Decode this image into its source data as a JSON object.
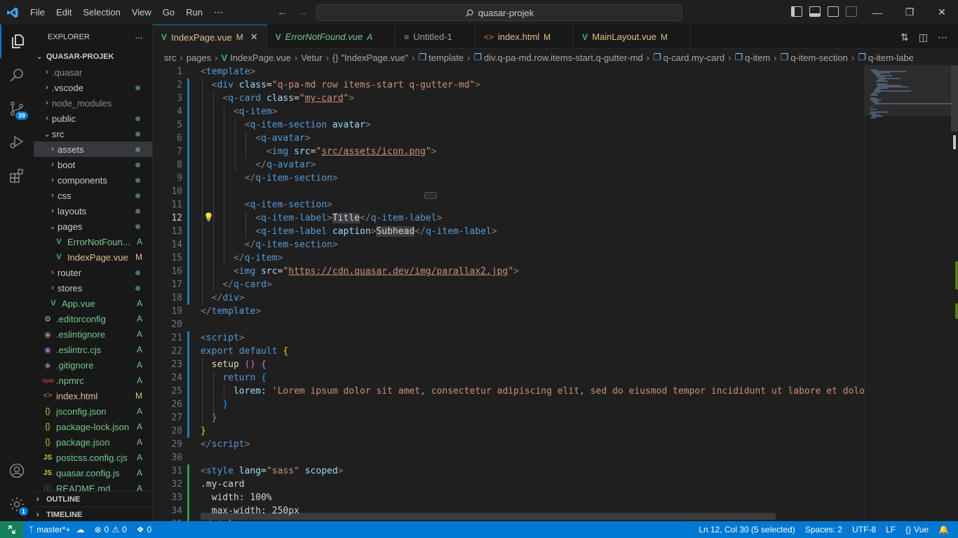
{
  "titlebar": {
    "menu": [
      "File",
      "Edit",
      "Selection",
      "View",
      "Go",
      "Run",
      "⋯"
    ],
    "command_center": "quasar-projek"
  },
  "activity": {
    "source_control_badge": "39",
    "settings_badge": "1"
  },
  "sidebar": {
    "title": "EXPLORER",
    "more": "···",
    "folder": "QUASAR-PROJEK",
    "items": [
      {
        "label": ".quasar",
        "kind": "folder",
        "depth": 1,
        "status": ""
      },
      {
        "label": ".vscode",
        "kind": "folder",
        "depth": 1,
        "status": "dot"
      },
      {
        "label": "node_modules",
        "kind": "folder",
        "depth": 1,
        "status": ""
      },
      {
        "label": "public",
        "kind": "folder",
        "depth": 1,
        "status": "dot"
      },
      {
        "label": "src",
        "kind": "folder-open",
        "depth": 1,
        "status": "dot"
      },
      {
        "label": "assets",
        "kind": "folder",
        "depth": 2,
        "status": "dot",
        "selected": true
      },
      {
        "label": "boot",
        "kind": "folder",
        "depth": 2,
        "status": "dot"
      },
      {
        "label": "components",
        "kind": "folder",
        "depth": 2,
        "status": "dot"
      },
      {
        "label": "css",
        "kind": "folder",
        "depth": 2,
        "status": "dot"
      },
      {
        "label": "layouts",
        "kind": "folder",
        "depth": 2,
        "status": "dotmod"
      },
      {
        "label": "pages",
        "kind": "folder-open",
        "depth": 2,
        "status": "dot"
      },
      {
        "label": "ErrorNotFoun...",
        "kind": "vue",
        "depth": 3,
        "status": "A"
      },
      {
        "label": "IndexPage.vue",
        "kind": "vue",
        "depth": 3,
        "status": "M"
      },
      {
        "label": "router",
        "kind": "folder",
        "depth": 2,
        "status": "dot"
      },
      {
        "label": "stores",
        "kind": "folder",
        "depth": 2,
        "status": "dot"
      },
      {
        "label": "App.vue",
        "kind": "vue",
        "depth": 2,
        "status": "A"
      },
      {
        "label": ".editorconfig",
        "kind": "cfg",
        "depth": 1,
        "status": "A"
      },
      {
        "label": ".eslintignore",
        "kind": "eslint",
        "depth": 1,
        "status": "A"
      },
      {
        "label": ".eslintrc.cjs",
        "kind": "eslintrc",
        "depth": 1,
        "status": "A"
      },
      {
        "label": ".gitignore",
        "kind": "git",
        "depth": 1,
        "status": "A"
      },
      {
        "label": ".npmrc",
        "kind": "npm",
        "depth": 1,
        "status": "A"
      },
      {
        "label": "index.html",
        "kind": "html",
        "depth": 1,
        "status": "M"
      },
      {
        "label": "jsconfig.json",
        "kind": "json",
        "depth": 1,
        "status": "A"
      },
      {
        "label": "package-lock.json",
        "kind": "json",
        "depth": 1,
        "status": "A"
      },
      {
        "label": "package.json",
        "kind": "json",
        "depth": 1,
        "status": "A"
      },
      {
        "label": "postcss.config.cjs",
        "kind": "js",
        "depth": 1,
        "status": "A"
      },
      {
        "label": "quasar.config.js",
        "kind": "js",
        "depth": 1,
        "status": "A"
      },
      {
        "label": "README.md",
        "kind": "info",
        "depth": 1,
        "status": "A"
      }
    ],
    "outline": "OUTLINE",
    "timeline": "TIMELINE"
  },
  "tabs": [
    {
      "label": "IndexPage.vue",
      "status": "M",
      "kind": "vue",
      "active": true,
      "close": "✕"
    },
    {
      "label": "ErrorNotFound.vue",
      "status": "A",
      "kind": "vue",
      "italic": true
    },
    {
      "label": "Untitled-1",
      "status": "",
      "kind": "text"
    },
    {
      "label": "index.html",
      "status": "M",
      "kind": "html"
    },
    {
      "label": "MainLayout.vue",
      "status": "M",
      "kind": "vue"
    }
  ],
  "breadcrumb": [
    "src",
    "pages",
    "IndexPage.vue",
    "Vetur",
    "{} \"IndexPage.vue\"",
    "template",
    "div.q-pa-md.row.items-start.q-gutter-md",
    "q-card.my-card",
    "q-item",
    "q-item-section",
    "q-item-labe"
  ],
  "editor": {
    "current_line": 12,
    "lines": [
      {
        "n": "1",
        "h": "<span class='t-br'>&lt;</span><span class='t-tag'>template</span><span class='t-br'>&gt;</span>"
      },
      {
        "n": "2",
        "h": "  <span class='t-br'>&lt;</span><span class='t-tag'>div</span> <span class='t-attr'>class</span>=<span class='t-str'>\"q-pa-md row items-start q-gutter-md\"</span><span class='t-br'>&gt;</span>"
      },
      {
        "n": "3",
        "h": "    <span class='t-br'>&lt;</span><span class='t-tag'>q-card</span> <span class='t-attr'>class</span>=<span class='t-str'>\"<span class='u'>my-card</span>\"</span><span class='t-br'>&gt;</span>"
      },
      {
        "n": "4",
        "h": "      <span class='t-br'>&lt;</span><span class='t-tag'>q-item</span><span class='t-br'>&gt;</span>"
      },
      {
        "n": "5",
        "h": "        <span class='t-br'>&lt;</span><span class='t-tag'>q-item-section</span> <span class='t-attr'>avatar</span><span class='t-br'>&gt;</span>"
      },
      {
        "n": "6",
        "h": "          <span class='t-br'>&lt;</span><span class='t-tag'>q-avatar</span><span class='t-br'>&gt;</span>"
      },
      {
        "n": "7",
        "h": "            <span class='t-br'>&lt;</span><span class='t-tag'>img</span> <span class='t-attr'>src</span>=<span class='t-str'>\"<span class='u'>src/assets/icon.png</span>\"</span><span class='t-br'>&gt;</span>"
      },
      {
        "n": "8",
        "h": "          <span class='t-br'>&lt;/</span><span class='t-tag'>q-avatar</span><span class='t-br'>&gt;</span>"
      },
      {
        "n": "9",
        "h": "        <span class='t-br'>&lt;/</span><span class='t-tag'>q-item-section</span><span class='t-br'>&gt;</span>"
      },
      {
        "n": "10",
        "h": ""
      },
      {
        "n": "11",
        "h": "        <span class='t-br'>&lt;</span><span class='t-tag'>q-item-section</span><span class='t-br'>&gt;</span>"
      },
      {
        "n": "12",
        "h": "          <span class='t-br'>&lt;</span><span class='t-tag'>q-item-label</span><span class='t-br'>&gt;</span><span class='t-sel'>Title</span><span class='t-br'>&lt;/</span><span class='t-tag'>q-item-label</span><span class='t-br'>&gt;</span>"
      },
      {
        "n": "13",
        "h": "          <span class='t-br'>&lt;</span><span class='t-tag'>q-item-label</span> <span class='t-attr'>caption</span><span class='t-br'>&gt;</span><span class='t-sel'>Subhead</span><span class='t-br'>&lt;/</span><span class='t-tag'>q-item-label</span><span class='t-br'>&gt;</span>"
      },
      {
        "n": "14",
        "h": "        <span class='t-br'>&lt;/</span><span class='t-tag'>q-item-section</span><span class='t-br'>&gt;</span>"
      },
      {
        "n": "15",
        "h": "      <span class='t-br'>&lt;/</span><span class='t-tag'>q-item</span><span class='t-br'>&gt;</span>"
      },
      {
        "n": "16",
        "h": "      <span class='t-br'>&lt;</span><span class='t-tag'>img</span> <span class='t-attr'>src</span>=<span class='t-str'>\"<span class='u'>https://cdn.quasar.dev/img/parallax2.jpg</span>\"</span><span class='t-br'>&gt;</span>"
      },
      {
        "n": "17",
        "h": "    <span class='t-br'>&lt;/</span><span class='t-tag'>q-card</span><span class='t-br'>&gt;</span>"
      },
      {
        "n": "18",
        "h": "  <span class='t-br'>&lt;/</span><span class='t-tag'>div</span><span class='t-br'>&gt;</span>"
      },
      {
        "n": "19",
        "h": "<span class='t-br'>&lt;/</span><span class='t-tag'>template</span><span class='t-br'>&gt;</span>"
      },
      {
        "n": "20",
        "h": ""
      },
      {
        "n": "21",
        "h": "<span class='t-br'>&lt;</span><span class='t-tag'>script</span><span class='t-br'>&gt;</span>"
      },
      {
        "n": "22",
        "h": "<span class='t-kw'>export</span> <span class='t-kw'>default</span> <span class='t-p1'>{</span>"
      },
      {
        "n": "23",
        "h": "  <span class='t-fn'>setup</span> <span class='t-p2'>()</span> <span class='t-p2'>{</span>"
      },
      {
        "n": "24",
        "h": "    <span class='t-kw'>return</span> <span class='t-p3'>{</span>"
      },
      {
        "n": "25",
        "h": "      <span class='t-attr'>lorem</span>: <span class='t-str'>'Lorem ipsum dolor sit amet, consectetur adipiscing elit, sed do eiusmod tempor incididunt ut labore et dolore</span>"
      },
      {
        "n": "26",
        "h": "    <span class='t-p3'>}</span>"
      },
      {
        "n": "27",
        "h": "  <span class='t-p2'>}</span>"
      },
      {
        "n": "28",
        "h": "<span class='t-p1'>}</span>"
      },
      {
        "n": "29",
        "h": "<span class='t-br'>&lt;/</span><span class='t-tag'>script</span><span class='t-br'>&gt;</span>"
      },
      {
        "n": "30",
        "h": ""
      },
      {
        "n": "31",
        "h": "<span class='t-br'>&lt;</span><span class='t-tag'>style</span> <span class='t-attr'>lang</span>=<span class='t-str'>\"sass\"</span> <span class='t-attr'>scoped</span><span class='t-br'>&gt;</span>"
      },
      {
        "n": "32",
        "h": "<span class='t-txt'>.my-card</span>"
      },
      {
        "n": "33",
        "h": "  <span class='t-txt'>width: 100%</span>"
      },
      {
        "n": "34",
        "h": "  <span class='t-txt'>max-width: 250px</span>"
      },
      {
        "n": "35",
        "h": "<span class='t-br'>&lt;/</span><span class='t-tag'>style</span><span class='t-br'>&gt;</span>"
      }
    ]
  },
  "statusbar": {
    "branch": "master*+",
    "errors": "0",
    "warnings": "0",
    "ports": "0",
    "position": "Ln 12, Col 30 (5 selected)",
    "spaces": "Spaces: 2",
    "encoding": "UTF-8",
    "eol": "LF",
    "language": "Vue"
  },
  "colors": {
    "accent": "#0078d4",
    "remote": "#16825d",
    "added": "#73c991",
    "modified": "#e2c08d"
  }
}
